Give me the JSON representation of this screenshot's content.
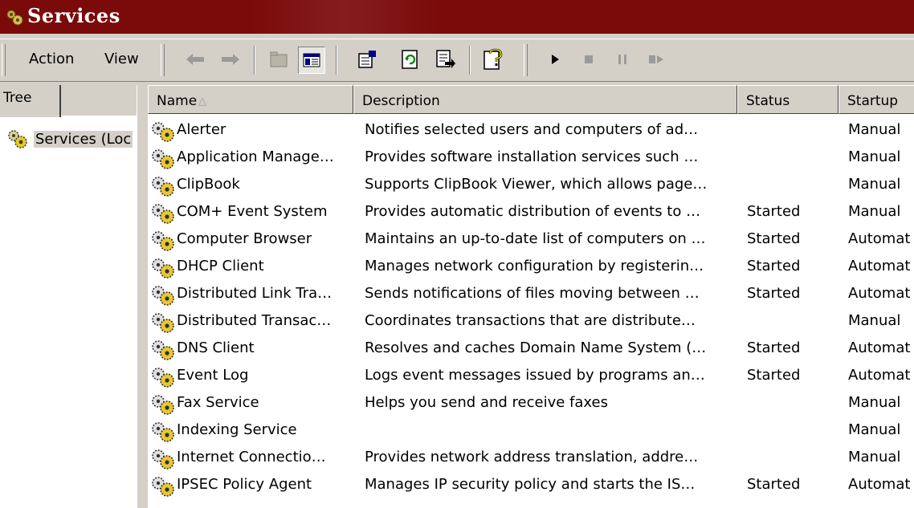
{
  "window": {
    "title": "Services"
  },
  "menu": {
    "action": "Action",
    "view": "View"
  },
  "toolbar_icons": [
    "back-arrow-icon",
    "forward-arrow-icon",
    "up-folder-icon",
    "show-hide-tree-icon",
    "properties-icon",
    "refresh-icon",
    "export-list-icon",
    "help-icon",
    "start-service-icon",
    "stop-service-icon",
    "pause-service-icon",
    "restart-service-icon"
  ],
  "tree": {
    "tab_label": "Tree",
    "root_label": "Services (Loc"
  },
  "list": {
    "columns": {
      "name": "Name",
      "description": "Description",
      "status": "Status",
      "startup": "Startup"
    },
    "rows": [
      {
        "name": "Alerter",
        "description": "Notifies selected users and computers of ad…",
        "status": "",
        "startup": "Manual"
      },
      {
        "name": "Application Manage…",
        "description": "Provides software installation services such …",
        "status": "",
        "startup": "Manual"
      },
      {
        "name": "ClipBook",
        "description": "Supports ClipBook Viewer, which allows page…",
        "status": "",
        "startup": "Manual"
      },
      {
        "name": "COM+ Event System",
        "description": "Provides automatic distribution of events to …",
        "status": "Started",
        "startup": "Manual"
      },
      {
        "name": "Computer Browser",
        "description": "Maintains an up-to-date list of computers on …",
        "status": "Started",
        "startup": "Automat"
      },
      {
        "name": "DHCP Client",
        "description": "Manages network configuration by registerin…",
        "status": "Started",
        "startup": "Automat"
      },
      {
        "name": "Distributed Link Tra…",
        "description": "Sends notifications of files moving between …",
        "status": "Started",
        "startup": "Automat"
      },
      {
        "name": "Distributed Transac…",
        "description": "Coordinates transactions that are distribute…",
        "status": "",
        "startup": "Manual"
      },
      {
        "name": "DNS Client",
        "description": "Resolves and caches Domain Name System (…",
        "status": "Started",
        "startup": "Automat"
      },
      {
        "name": "Event Log",
        "description": "Logs event messages issued by programs an…",
        "status": "Started",
        "startup": "Automat"
      },
      {
        "name": "Fax Service",
        "description": "Helps you send and receive faxes",
        "status": "",
        "startup": "Manual"
      },
      {
        "name": "Indexing Service",
        "description": "",
        "status": "",
        "startup": "Manual"
      },
      {
        "name": "Internet Connectio…",
        "description": "Provides network address translation, addre…",
        "status": "",
        "startup": "Manual"
      },
      {
        "name": "IPSEC Policy Agent",
        "description": "Manages IP security policy and starts the IS…",
        "status": "Started",
        "startup": "Automat"
      }
    ]
  },
  "colors": {
    "titlebar": "#7b0a0a",
    "chrome": "#d4d0c8",
    "list_bg": "#ffffff"
  }
}
